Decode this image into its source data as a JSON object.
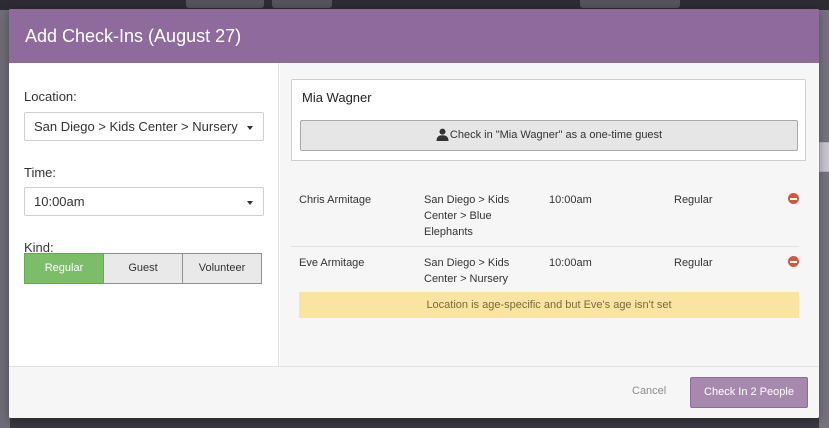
{
  "modal": {
    "title": "Add Check-Ins (August 27)"
  },
  "form": {
    "location_label": "Location:",
    "location_value": "San Diego > Kids Center > Nursery",
    "time_label": "Time:",
    "time_value": "10:00am",
    "kind_label": "Kind:",
    "kind_options": [
      "Regular",
      "Guest",
      "Volunteer"
    ],
    "kind_selected": "Regular"
  },
  "search": {
    "value": "Mia Wagner",
    "guest_button_label": "Check in \"Mia Wagner\" as a one-time guest"
  },
  "checkins": [
    {
      "name": "Chris Armitage",
      "location": "San Diego > Kids Center > Blue Elephants",
      "time": "10:00am",
      "kind": "Regular"
    },
    {
      "name": "Eve Armitage",
      "location": "San Diego > Kids Center > Nursery",
      "time": "10:00am",
      "kind": "Regular"
    }
  ],
  "warning": "Location is age-specific and but Eve's age isn't set",
  "footer": {
    "cancel_label": "Cancel",
    "submit_label": "Check In 2 People"
  },
  "colors": {
    "header": "#8f6a9c",
    "active_kind": "#7cbd69",
    "remove_icon": "#d2583a",
    "warning_bg": "#fbe3a2",
    "submit": "#a889ae"
  }
}
